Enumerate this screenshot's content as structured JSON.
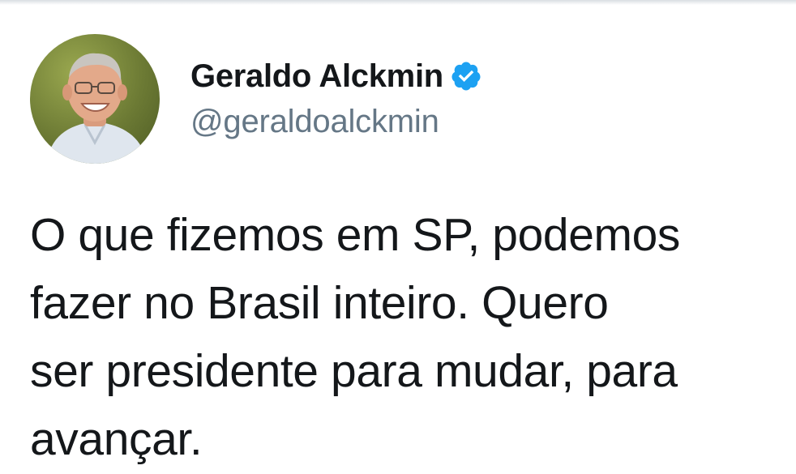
{
  "tweet": {
    "author": {
      "display_name": "Geraldo Alckmin",
      "handle": "@geraldoalckmin",
      "verified": true,
      "avatar_icon": "profile-photo"
    },
    "text": "O que fizemos em SP, podemos\nfazer no Brasil inteiro. Quero\nser presidente para mudar, para\navançar."
  },
  "colors": {
    "verified_badge": "#1da1f2",
    "name_text": "#14171a",
    "handle_text": "#657786"
  }
}
